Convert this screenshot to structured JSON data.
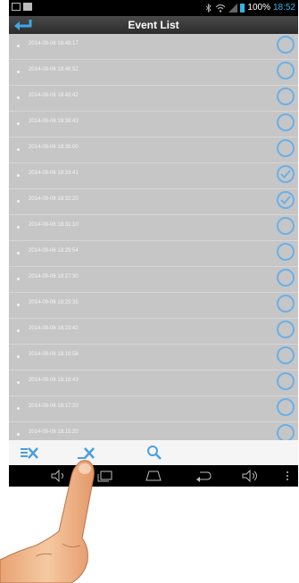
{
  "status_bar": {
    "battery": "100%",
    "time": "18:52"
  },
  "header": {
    "title": "Event List"
  },
  "events": [
    {
      "timestamp": "2014-09-06 18:48:17",
      "checked": false
    },
    {
      "timestamp": "2014-09-06 18:46:52",
      "checked": false
    },
    {
      "timestamp": "2014-09-06 18:43:42",
      "checked": false
    },
    {
      "timestamp": "2014-09-06 18:38:43",
      "checked": false
    },
    {
      "timestamp": "2014-09-06 18:35:00",
      "checked": false
    },
    {
      "timestamp": "2014-09-06 18:33:41",
      "checked": true
    },
    {
      "timestamp": "2014-09-06 18:32:20",
      "checked": true
    },
    {
      "timestamp": "2014-09-06 18:31:10",
      "checked": false
    },
    {
      "timestamp": "2014-09-06 18:29:54",
      "checked": false
    },
    {
      "timestamp": "2014-09-06 18:27:30",
      "checked": false
    },
    {
      "timestamp": "2014-09-06 18:25:35",
      "checked": false
    },
    {
      "timestamp": "2014-09-06 18:23:42",
      "checked": false
    },
    {
      "timestamp": "2014-09-06 18:19:58",
      "checked": false
    },
    {
      "timestamp": "2014-09-06 18:18:43",
      "checked": false
    },
    {
      "timestamp": "2014-09-06 18:17:20",
      "checked": false
    },
    {
      "timestamp": "2014-09-06 18:15:20",
      "checked": false
    }
  ],
  "toolbar": {
    "icons": [
      "delete-all-icon",
      "delete-selected-icon",
      "search-icon"
    ],
    "accent": "#4a9fe0"
  },
  "nav_bar": {
    "icons": [
      "volume-down-icon",
      "recent-apps-icon",
      "home-icon",
      "back-icon",
      "volume-up-icon",
      "overflow-menu-icon"
    ]
  },
  "colors": {
    "list_bg": "#c6c6c6",
    "check_ring": "#6bb0e8",
    "clock": "#34b5e5"
  }
}
